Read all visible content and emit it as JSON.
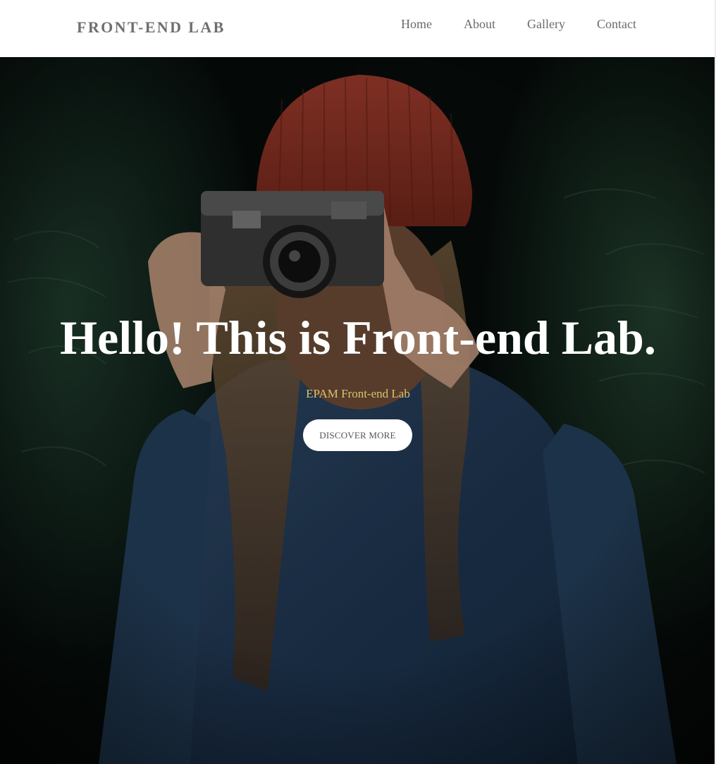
{
  "navbar": {
    "logo": "FRONT-END LAB",
    "links": [
      {
        "label": "Home"
      },
      {
        "label": "About"
      },
      {
        "label": "Gallery"
      },
      {
        "label": "Contact"
      }
    ]
  },
  "hero": {
    "title": "Hello! This is Front-end Lab.",
    "subtitle": "EPAM Front-end Lab",
    "button_label": "DISCOVER MORE",
    "image": "woman-with-camera-photo"
  },
  "colors": {
    "nav_background": "#ffffff",
    "nav_text": "#6b6b6b",
    "hero_title": "#ffffff",
    "hero_subtitle": "#d8c46a",
    "button_background": "#ffffff"
  }
}
